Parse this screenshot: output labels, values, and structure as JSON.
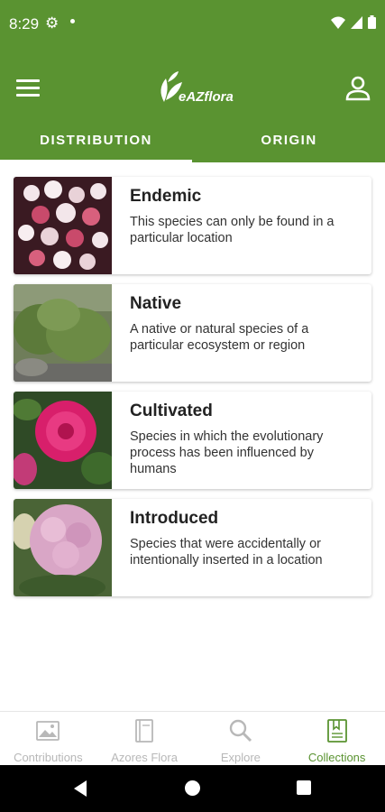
{
  "status_bar": {
    "time": "8:29"
  },
  "app_bar": {
    "logo_text": "eAZflora"
  },
  "tabs": [
    {
      "label": "DISTRIBUTION"
    },
    {
      "label": "ORIGIN"
    }
  ],
  "cards": [
    {
      "title": "Endemic",
      "description": "This species can only be found in a particular location",
      "image": "pink-white-flowers"
    },
    {
      "title": "Native",
      "description": "A native or natural species of a particular ecosystem or region",
      "image": "green-shrub"
    },
    {
      "title": "Cultivated",
      "description": "Species in which the evolutionary process has been influenced by humans",
      "image": "magenta-flower"
    },
    {
      "title": "Introduced",
      "description": "Species that were accidentally or intentionally inserted in a location",
      "image": "hydrangea"
    }
  ],
  "bottom_nav": [
    {
      "label": "Contributions",
      "icon": "image-icon"
    },
    {
      "label": "Azores Flora",
      "icon": "book-icon"
    },
    {
      "label": "Explore",
      "icon": "search-icon"
    },
    {
      "label": "Collections",
      "icon": "collections-icon",
      "active": true
    }
  ],
  "colors": {
    "primary": "#5a9331",
    "text": "#222222",
    "inactive": "#b8b8b8"
  }
}
